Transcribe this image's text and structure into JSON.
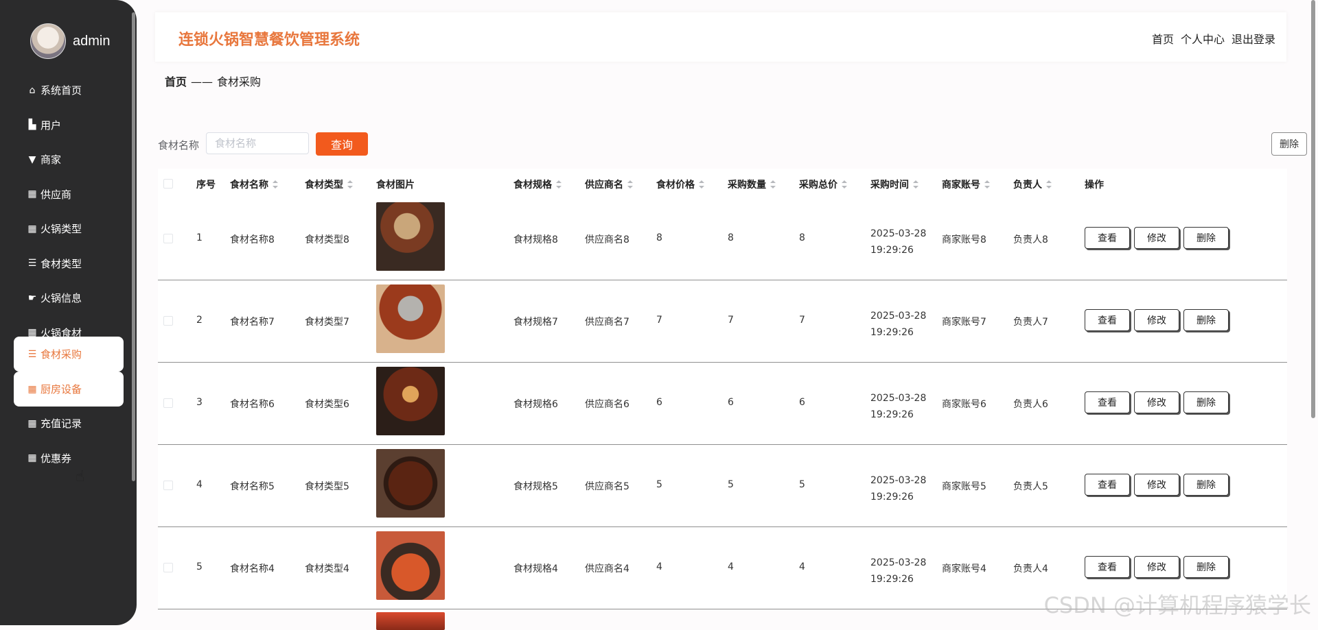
{
  "sidebar": {
    "username": "admin",
    "menu": [
      {
        "label": "系统首页",
        "icon": "home-icon",
        "glyph": "⌂",
        "active": false
      },
      {
        "label": "用户",
        "icon": "building-icon",
        "glyph": "▙",
        "active": false
      },
      {
        "label": "商家",
        "icon": "shop-icon",
        "glyph": "▼",
        "active": false
      },
      {
        "label": "供应商",
        "icon": "grid-icon",
        "glyph": "▦",
        "active": false
      },
      {
        "label": "火锅类型",
        "icon": "grid-icon",
        "glyph": "▦",
        "active": false
      },
      {
        "label": "食材类型",
        "icon": "sliders-icon",
        "glyph": "☰",
        "active": false
      },
      {
        "label": "火锅信息",
        "icon": "hand-icon",
        "glyph": "☛",
        "active": false
      },
      {
        "label": "火锅食材",
        "icon": "grid-icon",
        "glyph": "▦",
        "active": false
      },
      {
        "label": "食材采购",
        "icon": "list-icon",
        "glyph": "☰",
        "active": true
      },
      {
        "label": "厨房设备",
        "icon": "grid-icon",
        "glyph": "▦",
        "active": true
      },
      {
        "label": "充值记录",
        "icon": "grid-icon",
        "glyph": "▦",
        "active": false
      },
      {
        "label": "优惠券",
        "icon": "grid-icon",
        "glyph": "▦",
        "active": false
      }
    ]
  },
  "header": {
    "title": "连锁火锅智慧餐饮管理系统",
    "links": [
      "首页",
      "个人中心",
      "退出登录"
    ]
  },
  "breadcrumb": {
    "home": "首页",
    "sep": "——",
    "current": "食材采购"
  },
  "search": {
    "label": "食材名称",
    "placeholder": "食材名称",
    "query_button": "查询",
    "delete_button": "删除"
  },
  "table": {
    "headers": [
      "序号",
      "食材名称",
      "食材类型",
      "食材图片",
      "食材规格",
      "供应商名",
      "食材价格",
      "采购数量",
      "采购总价",
      "采购时间",
      "商家账号",
      "负责人",
      "操作"
    ],
    "action_labels": [
      "查看",
      "修改",
      "删除"
    ],
    "rows": [
      {
        "index": "1",
        "name": "食材名称8",
        "type": "食材类型8",
        "spec": "食材规格8",
        "supplier": "供应商名8",
        "price": "8",
        "qty": "8",
        "total": "8",
        "time": "2025-03-28 19:29:26",
        "account": "商家账号8",
        "owner": "负责人8"
      },
      {
        "index": "2",
        "name": "食材名称7",
        "type": "食材类型7",
        "spec": "食材规格7",
        "supplier": "供应商名7",
        "price": "7",
        "qty": "7",
        "total": "7",
        "time": "2025-03-28 19:29:26",
        "account": "商家账号7",
        "owner": "负责人7"
      },
      {
        "index": "3",
        "name": "食材名称6",
        "type": "食材类型6",
        "spec": "食材规格6",
        "supplier": "供应商名6",
        "price": "6",
        "qty": "6",
        "total": "6",
        "time": "2025-03-28 19:29:26",
        "account": "商家账号6",
        "owner": "负责人6"
      },
      {
        "index": "4",
        "name": "食材名称5",
        "type": "食材类型5",
        "spec": "食材规格5",
        "supplier": "供应商名5",
        "price": "5",
        "qty": "5",
        "total": "5",
        "time": "2025-03-28 19:29:26",
        "account": "商家账号5",
        "owner": "负责人5"
      },
      {
        "index": "5",
        "name": "食材名称4",
        "type": "食材类型4",
        "spec": "食材规格4",
        "supplier": "供应商名4",
        "price": "4",
        "qty": "4",
        "total": "4",
        "time": "2025-03-28 19:29:26",
        "account": "商家账号4",
        "owner": "负责人4"
      }
    ]
  },
  "watermark": "CSDN @计算机程序猿学长"
}
